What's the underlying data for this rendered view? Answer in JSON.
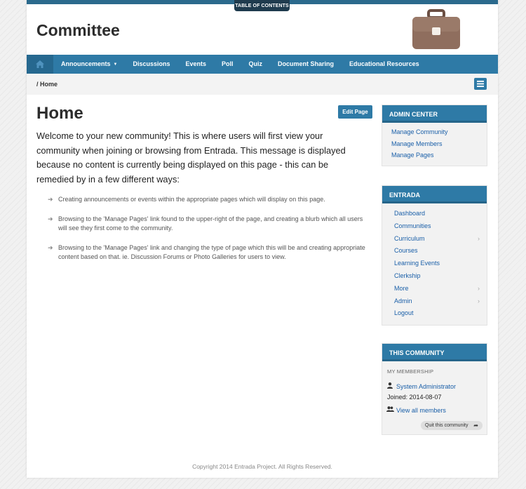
{
  "header": {
    "toc_label": "TABLE OF CONTENTS",
    "title": "Committee"
  },
  "nav": {
    "items": [
      "Announcements",
      "Discussions",
      "Events",
      "Poll",
      "Quiz",
      "Document Sharing",
      "Educational Resources"
    ],
    "caret": "▼"
  },
  "breadcrumb": {
    "separator": "/",
    "current": "Home"
  },
  "main": {
    "heading": "Home",
    "edit_label": "Edit Page",
    "intro": "Welcome to your new community! This is where users will first view your community when joining or browsing from Entrada. This message is displayed because no content is currently being displayed on this page - this can be remedied by in a few different ways:",
    "bullets": [
      "Creating announcements or events within the appropriate pages which will display on this page.",
      "Browsing to the 'Manage Pages' link found to the upper-right of the page, and creating a blurb which all users will see they first come to the community.",
      "Browsing to the 'Manage Pages' link and changing the type of page which this will be and creating appropriate content based on that. ie. Discussion Forums or Photo Galleries for users to view."
    ]
  },
  "admin_center": {
    "title": "ADMIN CENTER",
    "links": [
      "Manage Community",
      "Manage Members",
      "Manage Pages"
    ]
  },
  "entrada": {
    "title": "ENTRADA",
    "links": [
      "Dashboard",
      "Communities",
      "Curriculum",
      "Courses",
      "Learning Events",
      "Clerkship",
      "More",
      "Admin",
      "Logout"
    ]
  },
  "this_community": {
    "title": "THIS COMMUNITY",
    "membership_label": "MY MEMBERSHIP",
    "user_name": "System Administrator",
    "joined": "Joined: 2014-08-07",
    "view_all": "View all members",
    "quit_label": "Quit this community"
  },
  "footer": {
    "copyright": "Copyright 2014 Entrada Project. All Rights Reserved."
  },
  "colors": {
    "nav": "#2e7aa6",
    "nav_dark": "#26688f",
    "link": "#1a5fa8",
    "briefcase": "#8f6e5e"
  },
  "icons": {
    "home": "home-icon",
    "menu": "hamburger-menu-icon",
    "briefcase": "briefcase-icon",
    "user": "user-icon",
    "users": "users-icon",
    "arrow": "arrow-right-icon",
    "chevron": "chevron-right-icon",
    "share": "share-arrow-icon"
  }
}
